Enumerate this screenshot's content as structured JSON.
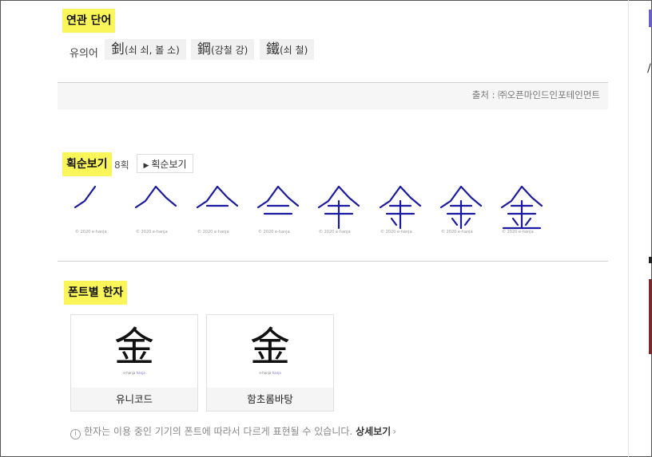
{
  "related": {
    "title": "연관 단어",
    "syn_label": "유의어",
    "chips": [
      {
        "hanja": "釗",
        "reading": "(쇠 쇠, 볼 소)"
      },
      {
        "hanja": "鋼",
        "reading": "(강철 강)"
      },
      {
        "hanja": "鐵",
        "reading": "(쇠 철)"
      }
    ],
    "source": "출처 : ㈜오픈마인드인포테인먼트"
  },
  "stroke_order": {
    "title": "획순보기",
    "count": "8획",
    "button": "획순보기",
    "copyright": "© 2020 e-hanja",
    "frames": 8
  },
  "fonts": {
    "title": "폰트별 한자",
    "character": "金",
    "watermark_prefix": "e-hanja",
    "watermark_brand": "hanja",
    "cards": [
      {
        "label": "유니코드"
      },
      {
        "label": "함초롬바탕"
      }
    ],
    "note": "한자는 이용 중인 기기의 폰트에 따라서 다르게 표현될 수 있습니다.",
    "more": "상세보기"
  },
  "colors": {
    "highlight": "#faf65a",
    "stroke_blue": "#1a1aa0"
  }
}
